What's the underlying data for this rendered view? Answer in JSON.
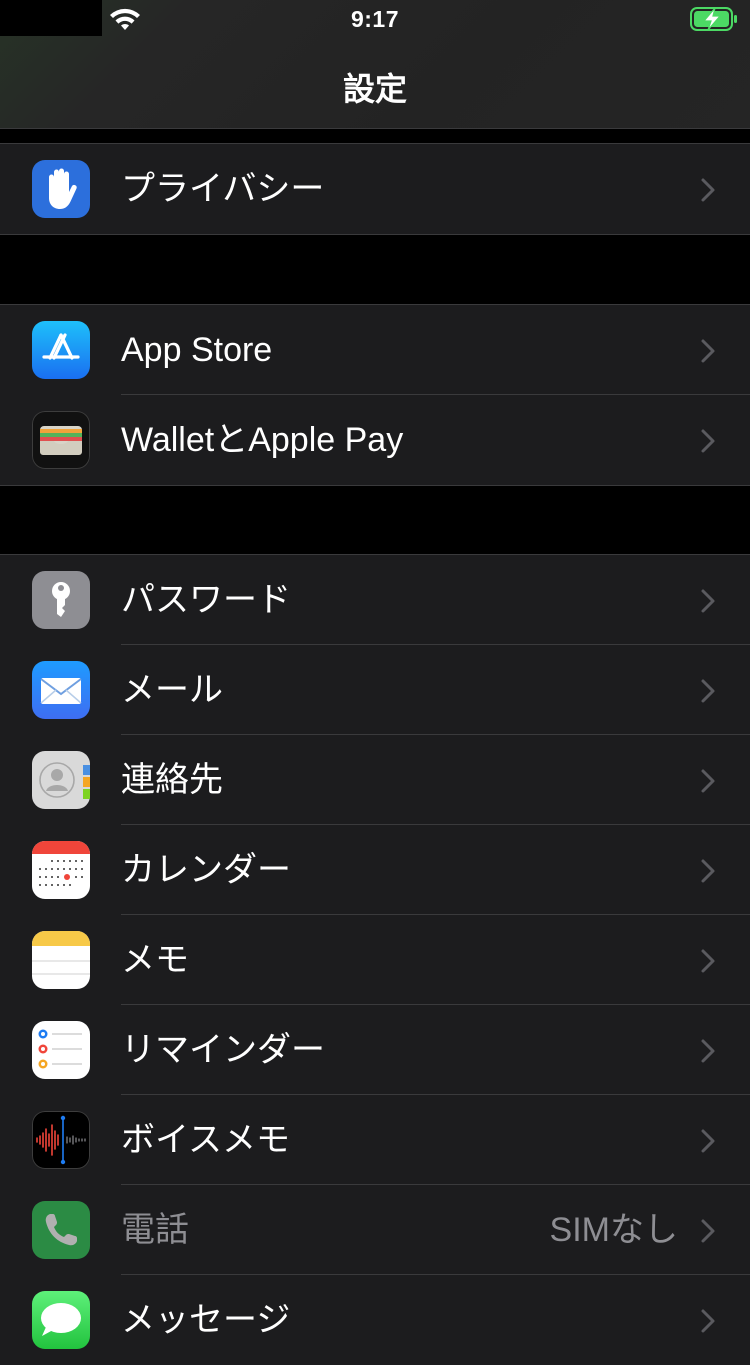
{
  "status_bar": {
    "time": "9:17",
    "wifi_icon": "wifi-icon",
    "battery_icon": "battery-charging-icon",
    "battery_color": "#4cd964"
  },
  "nav": {
    "title": "設定"
  },
  "groups": [
    {
      "items": [
        {
          "label": "プライバシー",
          "icon": "privacy-hand-icon",
          "color": "#2c6fdc"
        }
      ]
    },
    {
      "items": [
        {
          "label": "App Store",
          "icon": "app-store-icon",
          "color": "#1b8cf2"
        },
        {
          "label": "WalletとApple Pay",
          "icon": "wallet-icon",
          "color": "#111111"
        }
      ]
    },
    {
      "items": [
        {
          "label": "パスワード",
          "icon": "key-icon",
          "color": "#8e8e93"
        },
        {
          "label": "メール",
          "icon": "mail-icon",
          "color": "#2a7ff5"
        },
        {
          "label": "連絡先",
          "icon": "contacts-icon",
          "color": "#d8d8d8"
        },
        {
          "label": "カレンダー",
          "icon": "calendar-icon",
          "color": "#ffffff"
        },
        {
          "label": "メモ",
          "icon": "notes-icon",
          "color": "#ffffff"
        },
        {
          "label": "リマインダー",
          "icon": "reminders-icon",
          "color": "#ffffff"
        },
        {
          "label": "ボイスメモ",
          "icon": "voice-memos-icon",
          "color": "#000000"
        },
        {
          "label": "電話",
          "value": "SIMなし",
          "icon": "phone-icon",
          "color": "#34c759",
          "disabled": true
        },
        {
          "label": "メッセージ",
          "icon": "messages-icon",
          "color": "#34c759"
        }
      ]
    }
  ]
}
